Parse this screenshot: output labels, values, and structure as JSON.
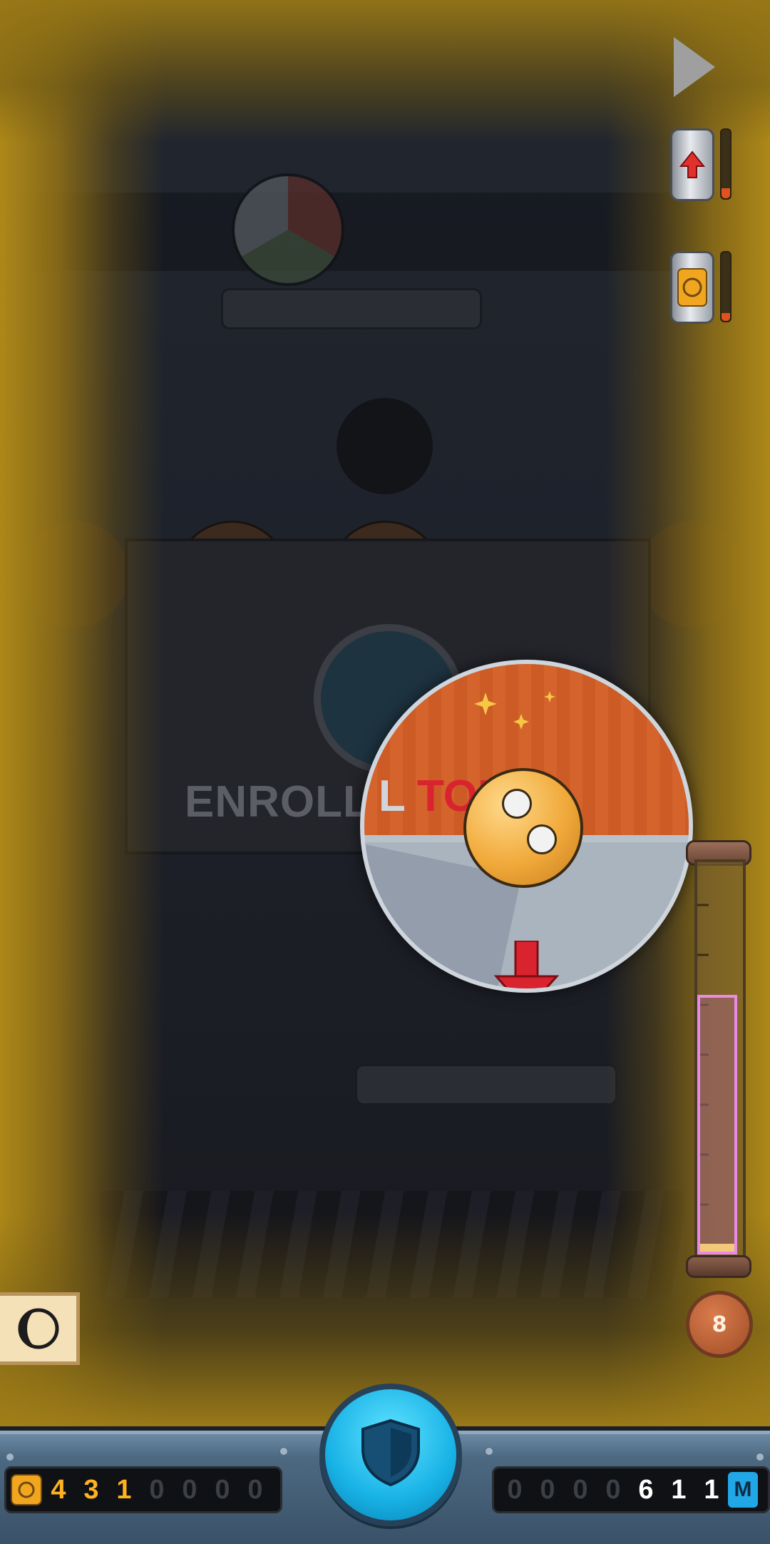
{
  "coins": {
    "icon": "coin-icon",
    "digits": [
      "4",
      "3",
      "1",
      "0",
      "0",
      "0",
      "0"
    ]
  },
  "distance": {
    "digits": [
      "0",
      "0",
      "0",
      "0",
      "6",
      "1",
      "1"
    ],
    "unit": "M"
  },
  "poster": {
    "title_left": "ENROLL",
    "title_right": "TOD",
    "bubble_prefix": "L ",
    "bubble_red": "TOD",
    "bubble_suffix": "!"
  },
  "powerups": [
    {
      "name": "boost-up",
      "icon": "arrow-up-icon",
      "level": 0.15
    },
    {
      "name": "coin-magnet",
      "icon": "coin-icon",
      "level": 0.12
    }
  ],
  "boost_meter": {
    "level": 0.03
  },
  "level_badge": "8",
  "colors": {
    "vignette": "#b08a18",
    "accent_blue": "#18b2e6",
    "coin_orange": "#ffb21f",
    "meter_pink": "#e98be6"
  }
}
